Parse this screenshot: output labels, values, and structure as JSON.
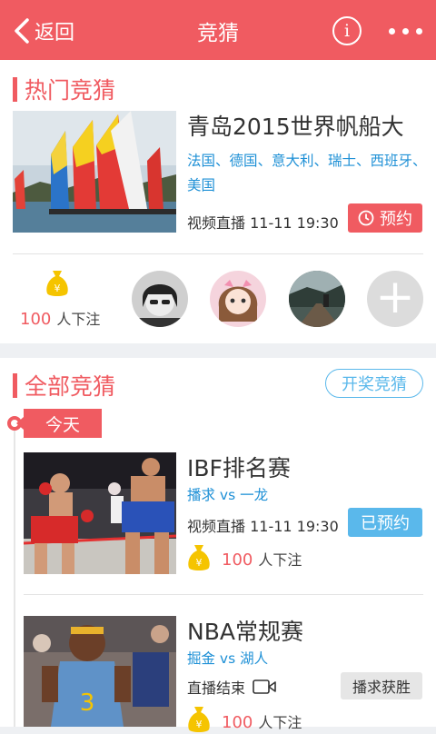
{
  "header": {
    "back_label": "返回",
    "title": "竞猜",
    "info_icon": "i",
    "bg_color": "#f05b61"
  },
  "hot": {
    "section_title": "热门竞猜",
    "event": {
      "title": "青岛2015世界帆船大",
      "teams": "法国、德国、意大利、瑞士、西班牙、美国",
      "meta": "视频直播  11-11  19:30",
      "button": "预约"
    },
    "bet_count": "100",
    "bet_suffix": "人下注",
    "add_icon": "+"
  },
  "all": {
    "section_title": "全部竞猜",
    "lottery_button": "开奖竞猜",
    "today_label": "今天",
    "events": [
      {
        "title": "IBF排名赛",
        "teams": "播求  vs  一龙",
        "meta": "视频直播  11-11  19:30",
        "button": "已预约",
        "bet_count": "100",
        "bet_suffix": "人下注"
      },
      {
        "title": "NBA常规赛",
        "teams": "掘金  vs  湖人",
        "meta": "直播结束",
        "button": "播求获胜",
        "bet_count": "100",
        "bet_suffix": "人下注"
      }
    ]
  },
  "colors": {
    "accent": "#f05b61",
    "blue": "#1e90d6",
    "light_blue": "#5ab8eb",
    "gold": "#f5c400"
  }
}
